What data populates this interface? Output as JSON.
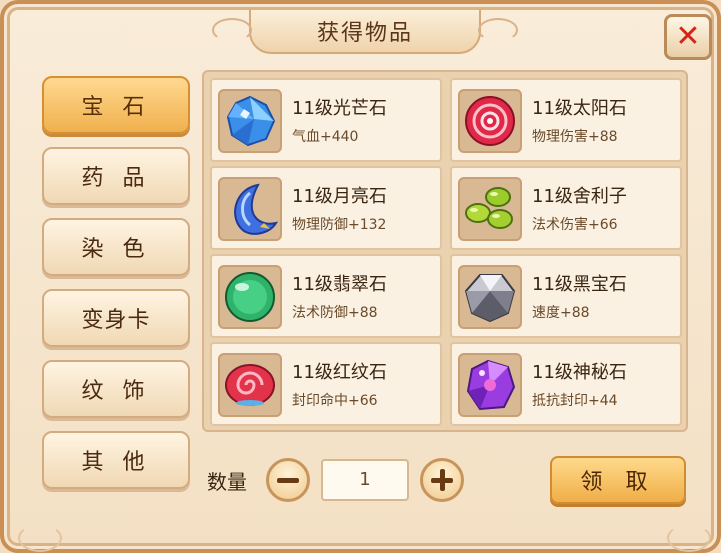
{
  "dialog": {
    "title": "获得物品",
    "close_icon": "close-x-icon"
  },
  "tabs": [
    {
      "label": "宝 石",
      "active": true
    },
    {
      "label": "药 品",
      "active": false
    },
    {
      "label": "染 色",
      "active": false
    },
    {
      "label": "变身卡",
      "active": false
    },
    {
      "label": "纹 饰",
      "active": false
    },
    {
      "label": "其 他",
      "active": false
    }
  ],
  "items": [
    {
      "name": "11级光芒石",
      "attr": "气血+440",
      "icon": "blue-crystal-gem-icon"
    },
    {
      "name": "11级太阳石",
      "attr": "物理伤害+88",
      "icon": "red-sun-gem-icon"
    },
    {
      "name": "11级月亮石",
      "attr": "物理防御+132",
      "icon": "crescent-moon-gem-icon"
    },
    {
      "name": "11级舍利子",
      "attr": "法术伤害+66",
      "icon": "green-beads-gem-icon"
    },
    {
      "name": "11级翡翠石",
      "attr": "法术防御+88",
      "icon": "green-jade-orb-icon"
    },
    {
      "name": "11级黑宝石",
      "attr": "速度+88",
      "icon": "black-diamond-gem-icon"
    },
    {
      "name": "11级红纹石",
      "attr": "封印命中+66",
      "icon": "red-swirl-gem-icon"
    },
    {
      "name": "11级神秘石",
      "attr": "抵抗封印+44",
      "icon": "purple-mystic-gem-icon"
    }
  ],
  "quantity": {
    "label": "数量",
    "value": "1",
    "minus_icon": "minus-icon",
    "plus_icon": "plus-icon"
  },
  "claim_button": "领 取",
  "colors": {
    "active_tab": "#f0b04d",
    "close_x": "#d32418",
    "panel_bg": "#f9ecd9"
  }
}
